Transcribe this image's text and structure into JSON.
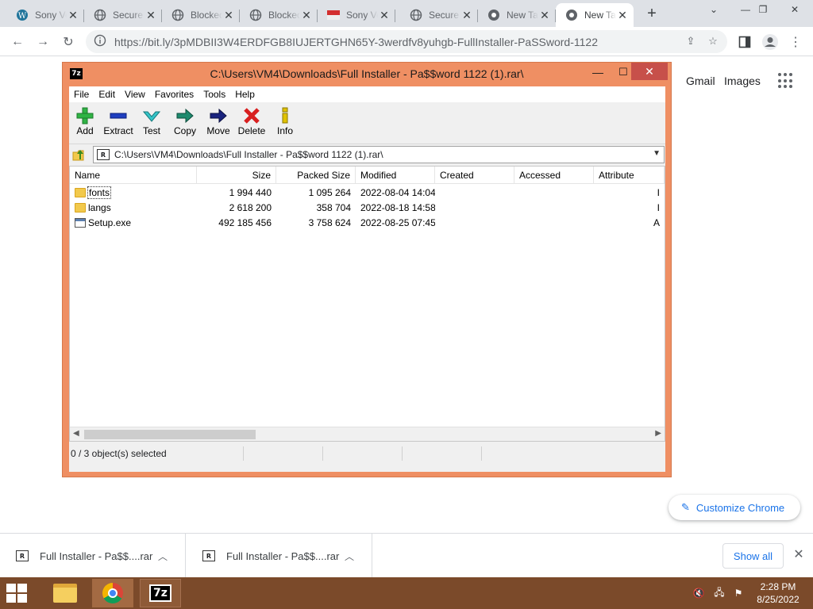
{
  "browser": {
    "tabs": [
      {
        "label": "Sony Vegas Pro",
        "icon": "wordpress-icon",
        "active": false
      },
      {
        "label": "Secure Download",
        "icon": "globe-icon",
        "active": false
      },
      {
        "label": "Blocked",
        "icon": "globe-icon",
        "active": false
      },
      {
        "label": "Blocked",
        "icon": "globe-icon",
        "active": false
      },
      {
        "label": "Sony Vegas",
        "icon": "flag-icon",
        "active": false
      },
      {
        "label": "Secure Download",
        "icon": "globe-icon",
        "active": false
      },
      {
        "label": "New Tab",
        "icon": "chrome-icon",
        "active": false
      },
      {
        "label": "New Tab",
        "icon": "chrome-icon",
        "active": true
      }
    ],
    "url": "https://bit.ly/3pMDBII3W4ERDFGB8IUJERTGHN65Y-3werdfv8yuhgb-FullInstaller-PaSSword-1122"
  },
  "newtab": {
    "gmail": "Gmail",
    "images": "Images",
    "customize": "Customize Chrome"
  },
  "zip": {
    "title": "C:\\Users\\VM4\\Downloads\\Full Installer - Pa$$word 1122 (1).rar\\",
    "app_icon": "7z",
    "menu": [
      "File",
      "Edit",
      "View",
      "Favorites",
      "Tools",
      "Help"
    ],
    "toolbar": [
      {
        "label": "Add",
        "icon": "plus-icon",
        "color": "#2fb344"
      },
      {
        "label": "Extract",
        "icon": "minus-icon",
        "color": "#1f3fbf"
      },
      {
        "label": "Test",
        "icon": "check-icon",
        "color": "#35c5c9"
      },
      {
        "label": "Copy",
        "icon": "copy-arrow-icon",
        "color": "#1e8a6e"
      },
      {
        "label": "Move",
        "icon": "move-arrow-icon",
        "color": "#1a237e"
      },
      {
        "label": "Delete",
        "icon": "delete-x-icon",
        "color": "#d81f1f"
      },
      {
        "label": "Info",
        "icon": "info-icon",
        "color": "#e0c200"
      }
    ],
    "address": "C:\\Users\\VM4\\Downloads\\Full Installer - Pa$$word 1122 (1).rar\\",
    "columns": [
      "Name",
      "Size",
      "Packed Size",
      "Modified",
      "Created",
      "Accessed",
      "Attribute"
    ],
    "rows": [
      {
        "name": "fonts",
        "type": "folder",
        "size": "1 994 440",
        "packed": "1 095 264",
        "modified": "2022-08-04 14:04",
        "created": "",
        "accessed": "",
        "attr": "I"
      },
      {
        "name": "langs",
        "type": "folder",
        "size": "2 618 200",
        "packed": "358 704",
        "modified": "2022-08-18 14:58",
        "created": "",
        "accessed": "",
        "attr": "I"
      },
      {
        "name": "Setup.exe",
        "type": "exe",
        "size": "492 185 456",
        "packed": "3 758 624",
        "modified": "2022-08-25 07:45",
        "created": "",
        "accessed": "",
        "attr": "A"
      }
    ],
    "status": "0 / 3 object(s) selected"
  },
  "downloads": {
    "items": [
      {
        "name": "Full Installer - Pa$$....rar"
      },
      {
        "name": "Full Installer - Pa$$....rar"
      }
    ],
    "show_all": "Show all"
  },
  "taskbar": {
    "time": "2:28 PM",
    "date": "8/25/2022",
    "sz_label": "7z"
  }
}
